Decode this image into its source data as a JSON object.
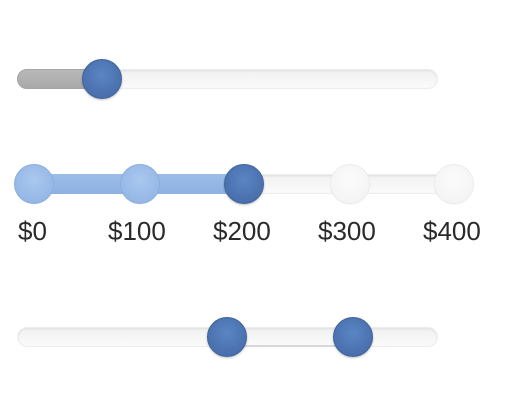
{
  "single_slider": {
    "value_fraction": 0.2
  },
  "stepped_slider": {
    "steps": [
      "$0",
      "$100",
      "$200",
      "$300",
      "$400"
    ],
    "selected_index": 2,
    "colors": {
      "active": "#4a70ad",
      "filled": "#96b8e6",
      "empty": "#f2f2f2"
    }
  },
  "range_slider": {
    "low_fraction": 0.5,
    "high_fraction": 0.8
  },
  "colors": {
    "handle": "#4a70ad",
    "track": "#f4f4f4",
    "fill_gray": "#b0b0b0"
  }
}
